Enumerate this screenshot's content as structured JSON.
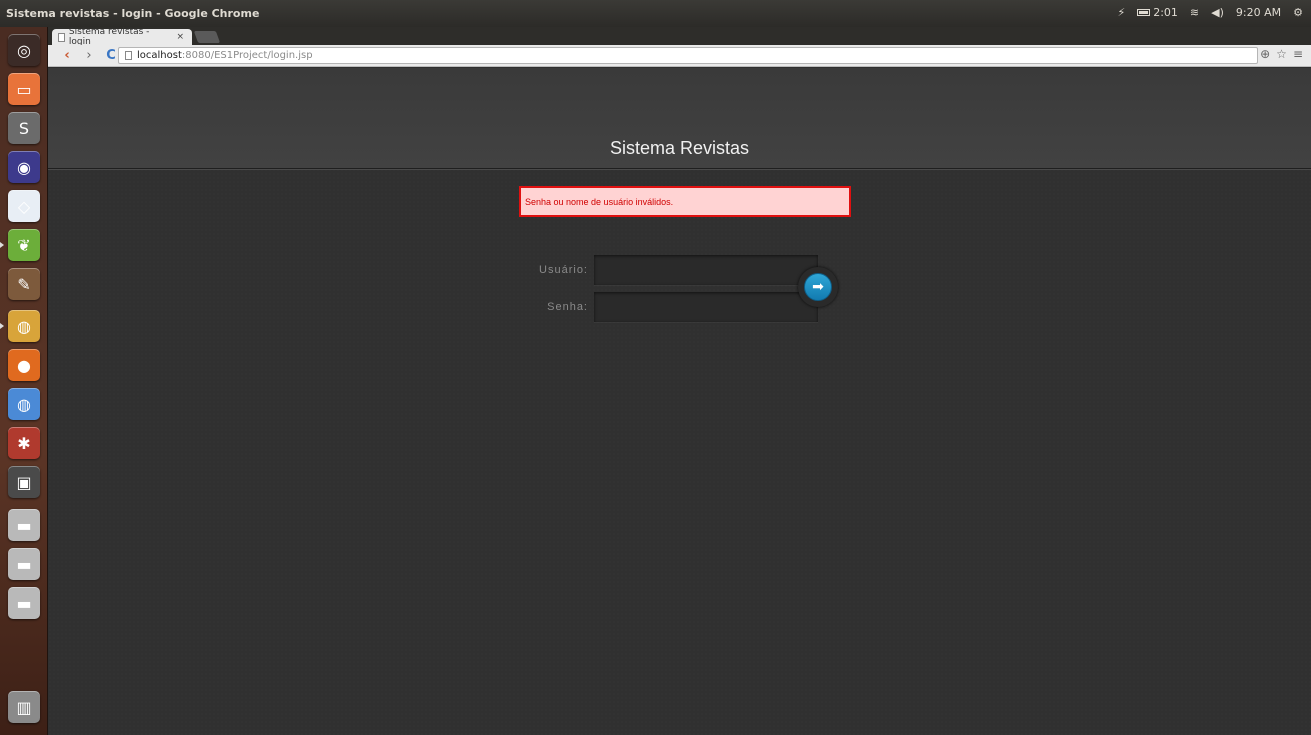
{
  "system": {
    "window_title": "Sistema revistas - login - Google Chrome",
    "battery": "2:01",
    "clock": "9:20 AM"
  },
  "launcher": {
    "items": [
      {
        "name": "ubuntu-dash-icon",
        "color": "#3b2b27"
      },
      {
        "name": "files-icon",
        "color": "#e8733a"
      },
      {
        "name": "sublime-text-icon",
        "color": "#6b6b6b"
      },
      {
        "name": "eclipse-icon",
        "color": "#3d3a8c"
      },
      {
        "name": "mysql-workbench-icon",
        "color": "#e8eef5"
      },
      {
        "name": "spring-tool-icon",
        "color": "#6cae3a"
      },
      {
        "name": "brush-tool-icon",
        "color": "#7d5a3c"
      },
      {
        "name": "chrome-icon",
        "color": "#d8a43a"
      },
      {
        "name": "firefox-icon",
        "color": "#e06a1f"
      },
      {
        "name": "chromium-icon",
        "color": "#4b8ad6"
      },
      {
        "name": "system-settings-icon",
        "color": "#b03a2e"
      },
      {
        "name": "terminal-icon",
        "color": "#4a4a4a"
      },
      {
        "name": "drive-icon",
        "color": "#b9b9b9"
      },
      {
        "name": "drive-icon",
        "color": "#b9b9b9"
      },
      {
        "name": "drive-icon",
        "color": "#b9b9b9"
      },
      {
        "name": "trash-icon",
        "color": "#8a8a8a"
      }
    ]
  },
  "browser": {
    "tab_title": "Sistema revistas - login",
    "tab_close": "×",
    "url_host": "localhost",
    "url_rest": ":8080/ES1Project/login.jsp"
  },
  "page": {
    "title": "Sistema Revistas",
    "error_message": "Senha ou nome de usuário inválidos.",
    "username_label": "Usuário:",
    "password_label": "Senha:",
    "username_value": "",
    "password_value": "",
    "submit_glyph": "➡"
  }
}
